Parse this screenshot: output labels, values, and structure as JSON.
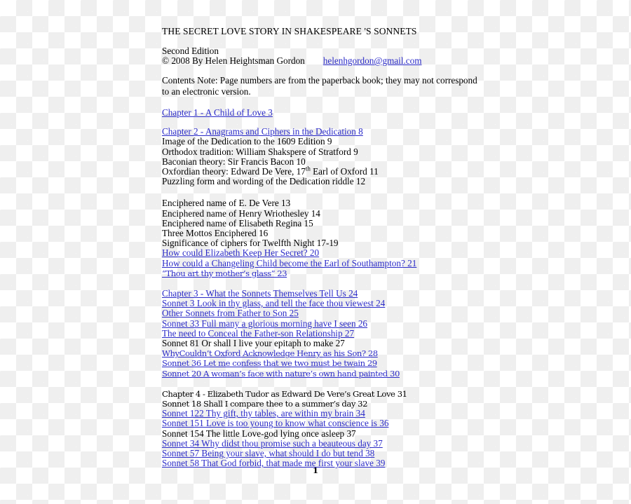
{
  "document": {
    "title": "THE SECRET LOVE STORY IN SHAKESPEARE 'S SONNETS",
    "edition": "Second Edition",
    "copyright": "© 2008 By Helen Heightsman Gordon",
    "email": "helenhgordon@gmail.com",
    "contents_note": "Contents  Note: Page numbers are from the paperback book; they may not correspond to an electronic version.",
    "page_number": "1",
    "link_color": "#2b2bc8",
    "text_color": "#000000"
  },
  "toc": {
    "chapter1": {
      "heading": "Chapter 1 - A Child of Love 3"
    },
    "chapter2": {
      "heading": "Chapter 2 - Anagrams and Ciphers in the Dedication 8",
      "entries": [
        "Image of the Dedication to the 1609 Edition 9",
        "Orthodox tradition: William Shakspere of Stratford 9",
        "Baconian theory: Sir Francis Bacon 10",
        "Puzzling form and wording of the Dedication riddle 12"
      ],
      "oxfordian_pre": "Oxfordian theory: Edward De Vere, 17",
      "oxfordian_sup": "th",
      "oxfordian_post": " Earl of Oxford 11",
      "entries2": [
        "Enciphered name of E. De Vere 13",
        "Enciphered name of Henry Wriothesley 14",
        "Enciphered name of Elisabeth Regina 15",
        "Three Mottos Enciphered 16",
        "Significance of ciphers for Twelfth Night 17-19"
      ],
      "links2": [
        "How could Elizabeth Keep Her Secret? 20",
        "How could a Changeling Child become the Earl of Southampton? 21",
        "“Thou art thy mother’s glass” 23"
      ]
    },
    "chapter3": {
      "heading": "Chapter 3 - What the Sonnets Themselves Tell Us 24",
      "items": [
        {
          "text": "Sonnet 3 Look in thy glass, and tell the face thou viewest 24",
          "link": true,
          "alt": false
        },
        {
          "text": "Other Sonnets from Father to Son 25",
          "link": true,
          "alt": false
        },
        {
          "text": "Sonnet 33 Full many a glorious morning have I seen 26",
          "link": true,
          "alt": false
        },
        {
          "text": "The need to Conceal the Father-son Relationship 27",
          "link": true,
          "alt": false
        },
        {
          "text": "Sonnet 81 Or shall I live your epitaph to make 27",
          "link": false,
          "alt": false
        },
        {
          "text": "WhyCouldn’t Oxford Acknowledge Henry as his Son? 28",
          "link": true,
          "alt": true
        },
        {
          "text": "Sonnet 36 Let me confess that we two must be twain 29",
          "link": true,
          "alt": true
        },
        {
          "text": "Sonnet 20 A woman’s face with nature’s own hand painted 30",
          "link": true,
          "alt": true
        }
      ]
    },
    "chapter4": {
      "heading": "Chapter 4 - Elizabeth Tudor as Edward De Vere’s Great Love 31",
      "items": [
        {
          "text": "Sonnet 18 Shall I compare thee to a summer’s day 32",
          "link": false,
          "alt": true
        },
        {
          "text": "Sonnet 122 Thy gift, thy tables, are within my brain 34",
          "link": true,
          "alt": false
        },
        {
          "text": "Sonnet 151 Love is too young to know what conscience is 36",
          "link": true,
          "alt": false
        },
        {
          "text": "Sonnet 154 The little Love-god lying once asleep 37",
          "link": false,
          "alt": false
        },
        {
          "text": "Sonnet 34 Why didst thou promise such a beauteous day 37",
          "link": true,
          "alt": false
        },
        {
          "text": "Sonnet 57 Being your slave, what should I do but tend 38",
          "link": true,
          "alt": false
        },
        {
          "text": "Sonnet 58 That God forbid, that made me first your slave 39",
          "link": true,
          "alt": false
        }
      ]
    }
  }
}
